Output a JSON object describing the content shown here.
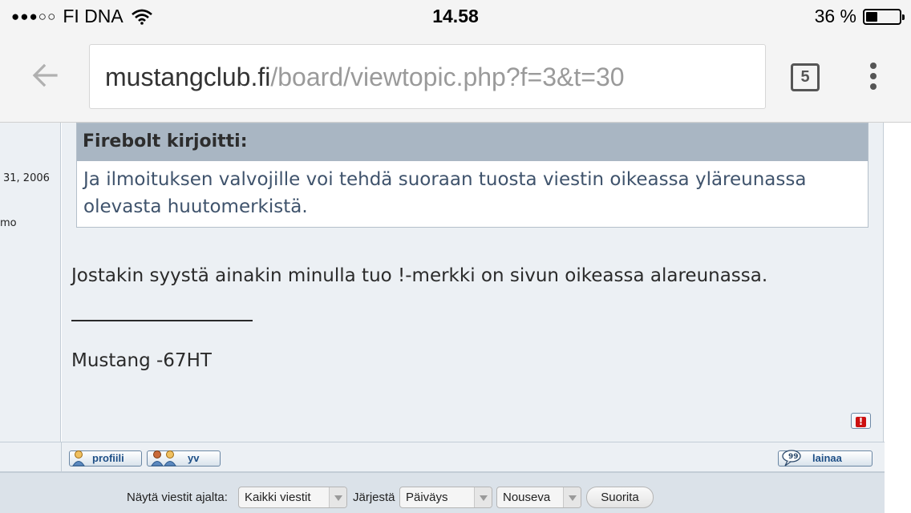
{
  "status_bar": {
    "signal": "●●●○○",
    "carrier": "FI DNA",
    "time": "14.58",
    "battery_percent": "36 %",
    "battery_level": 0.36
  },
  "browser": {
    "url_domain": "mustangclub.fi",
    "url_path": "/board/viewtopic.php?f=3&t=30",
    "tab_count": "5"
  },
  "post": {
    "author_joined": "31, 2006",
    "author_location": "mo",
    "quote": {
      "header": "Firebolt kirjoitti:",
      "text": "Ja ilmoituksen valvojille voi tehdä suoraan tuosta viestin oikeassa yläreunassa olevasta huutomerkistä."
    },
    "message": "Jostakin syystä ainakin minulla tuo !-merkki on sivun oikeassa alareunassa.",
    "signature": "Mustang -67HT",
    "report_icon": "!",
    "buttons": {
      "profile": "profiili",
      "pm": "yv",
      "quote": "lainaa"
    }
  },
  "filter": {
    "show_label": "Näytä viestit ajalta:",
    "show_value": "Kaikki viestit",
    "sort_label": "Järjestä",
    "sort_value": "Päiväys",
    "order_value": "Nouseva",
    "go_label": "Suorita"
  }
}
